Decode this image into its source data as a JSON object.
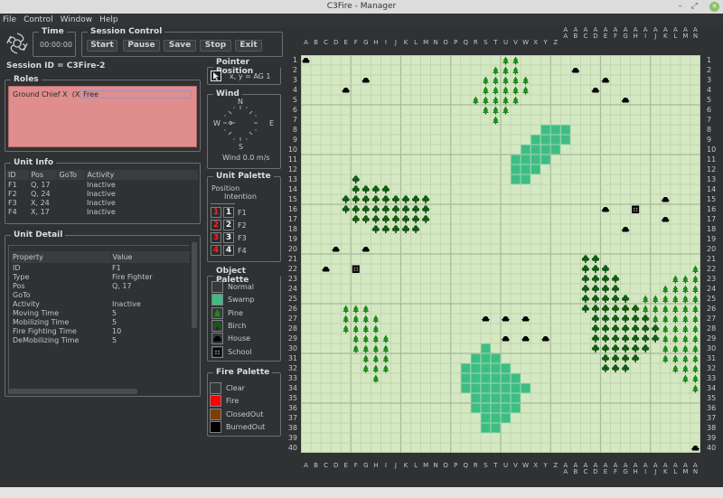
{
  "window": {
    "title": "C3Fire - Manager",
    "controls": {
      "minimize": "–",
      "maximize": "⤢",
      "close": "✕"
    }
  },
  "menu": [
    "File",
    "Control",
    "Window",
    "Help"
  ],
  "time": {
    "title": "Time",
    "value": "00:00:00"
  },
  "session_control": {
    "title": "Session Control",
    "buttons": [
      "Start",
      "Pause",
      "Save",
      "Stop",
      "Exit"
    ]
  },
  "session_id": "Session ID = C3Fire-2",
  "roles": {
    "title": "Roles",
    "role": "Ground Chief X",
    "marker": "(X)",
    "value": "Free"
  },
  "unit_info": {
    "title": "Unit Info",
    "columns": [
      "ID",
      "Pos",
      "GoTo",
      "Activity"
    ],
    "rows": [
      [
        "F1",
        "Q, 17",
        "",
        "Inactive"
      ],
      [
        "F2",
        "Q, 24",
        "",
        "Inactive"
      ],
      [
        "F3",
        "X, 24",
        "",
        "Inactive"
      ],
      [
        "F4",
        "X, 17",
        "",
        "Inactive"
      ]
    ]
  },
  "unit_detail": {
    "title": "Unit Detail",
    "columns": [
      "Property",
      "Value"
    ],
    "rows": [
      [
        "ID",
        "F1"
      ],
      [
        "Type",
        "Fire Fighter"
      ],
      [
        "Pos",
        "Q, 17"
      ],
      [
        "GoTo",
        ""
      ],
      [
        "Activity",
        "Inactive"
      ],
      [
        "Moving Time",
        "5"
      ],
      [
        "Mobilizing Time",
        "5"
      ],
      [
        "Fire Fighting Time",
        "10"
      ],
      [
        "DeMobilizing Time",
        "5"
      ]
    ]
  },
  "pointer_position": {
    "title": "Pointer Position",
    "icon": "arrow-pointer-icon",
    "text": "x, y  =  AG 1"
  },
  "wind": {
    "title": "Wind",
    "n": "N",
    "s": "S",
    "e": "E",
    "w": "W",
    "speed_text": "Wind 0.0 m/s"
  },
  "unit_palette": {
    "title": "Unit Palette",
    "position_label": "Position",
    "intention_label": "Intention",
    "units": [
      {
        "num": "1",
        "label": "F1"
      },
      {
        "num": "2",
        "label": "F2"
      },
      {
        "num": "3",
        "label": "F3"
      },
      {
        "num": "4",
        "label": "F4"
      }
    ]
  },
  "object_palette": {
    "title": "Object Palette",
    "items": [
      {
        "label": "Normal",
        "icon": "normal-icon",
        "color": "#36393c"
      },
      {
        "label": "Swamp",
        "icon": "swamp-icon",
        "color": "#3dbd84"
      },
      {
        "label": "Pine",
        "icon": "pine-icon",
        "color": "#1f8a1f"
      },
      {
        "label": "Birch",
        "icon": "birch-icon",
        "color": "#1c6e1c"
      },
      {
        "label": "House",
        "icon": "house-icon",
        "color": "#000000"
      },
      {
        "label": "School",
        "icon": "school-icon",
        "color": "#000000"
      }
    ]
  },
  "fire_palette": {
    "title": "Fire Palette",
    "items": [
      {
        "label": "Clear",
        "color": "#36393c"
      },
      {
        "label": "Fire",
        "color": "#ff0000"
      },
      {
        "label": "ClosedOut",
        "color": "#7a3e00"
      },
      {
        "label": "BurnedOut",
        "color": "#000000"
      }
    ]
  },
  "map": {
    "columns": [
      "A",
      "B",
      "C",
      "D",
      "E",
      "F",
      "G",
      "H",
      "I",
      "J",
      "K",
      "L",
      "M",
      "N",
      "O",
      "P",
      "Q",
      "R",
      "S",
      "T",
      "U",
      "V",
      "W",
      "X",
      "Y",
      "Z",
      "AA",
      "AB",
      "AC",
      "AD",
      "AE",
      "AF",
      "AG",
      "AH",
      "AI",
      "AJ",
      "AK",
      "AL",
      "AM",
      "AN"
    ],
    "rows": 40,
    "colors": {
      "ground": "#d4e8c2",
      "grid": "#bccfac",
      "major_grid": "#a9b89b",
      "swamp": "#3dbd84",
      "swamp_border": "#6fd3a2",
      "pine": "#1d8a1d",
      "birch": "#145c14",
      "house": "#000000"
    },
    "swamp": {
      "8": [
        "Y",
        "Z",
        "AA"
      ],
      "9": [
        "X",
        "Y",
        "Z",
        "AA"
      ],
      "10": [
        "W",
        "X",
        "Y",
        "Z"
      ],
      "11": [
        "V",
        "W",
        "X",
        "Y"
      ],
      "12": [
        "V",
        "W",
        "X"
      ],
      "13": [
        "V",
        "W"
      ],
      "30": [
        "S"
      ],
      "31": [
        "R",
        "S",
        "T"
      ],
      "32": [
        "Q",
        "R",
        "S",
        "T",
        "U"
      ],
      "33": [
        "Q",
        "R",
        "S",
        "T",
        "U",
        "V"
      ],
      "34": [
        "Q",
        "R",
        "S",
        "T",
        "U",
        "V",
        "W"
      ],
      "35": [
        "R",
        "S",
        "T",
        "U",
        "V"
      ],
      "36": [
        "R",
        "S",
        "T",
        "U",
        "V"
      ],
      "37": [
        "S",
        "T",
        "U"
      ],
      "38": [
        "S",
        "T"
      ]
    },
    "pine": {
      "1": [
        "U",
        "V"
      ],
      "2": [
        "T",
        "U",
        "V"
      ],
      "3": [
        "S",
        "T",
        "U",
        "V",
        "W"
      ],
      "4": [
        "S",
        "T",
        "U",
        "V",
        "W"
      ],
      "5": [
        "R",
        "S",
        "T",
        "U",
        "V"
      ],
      "6": [
        "S",
        "T",
        "U"
      ],
      "7": [
        "T"
      ],
      "22": [
        "AN"
      ],
      "23": [
        "AL",
        "AM",
        "AN"
      ],
      "24": [
        "AK",
        "AL",
        "AM",
        "AN"
      ],
      "25": [
        "AI",
        "AJ",
        "AK",
        "AL",
        "AM",
        "AN"
      ],
      "26": [
        "E",
        "F",
        "G",
        "AI",
        "AJ",
        "AK",
        "AL",
        "AM",
        "AN"
      ],
      "27": [
        "E",
        "F",
        "G",
        "H",
        "AJ",
        "AK",
        "AL",
        "AM",
        "AN"
      ],
      "28": [
        "E",
        "F",
        "G",
        "H",
        "AK",
        "AL",
        "AM",
        "AN"
      ],
      "29": [
        "F",
        "G",
        "H",
        "I",
        "AK",
        "AL",
        "AM",
        "AN"
      ],
      "30": [
        "F",
        "G",
        "H",
        "I",
        "AK",
        "AL",
        "AM",
        "AN"
      ],
      "31": [
        "G",
        "H",
        "I",
        "AK",
        "AL",
        "AM",
        "AN"
      ],
      "32": [
        "G",
        "H",
        "I",
        "AL",
        "AM",
        "AN"
      ],
      "33": [
        "H",
        "AM",
        "AN"
      ],
      "34": [
        "AN"
      ]
    },
    "birch": {
      "13": [
        "F"
      ],
      "14": [
        "F",
        "G",
        "H",
        "I"
      ],
      "15": [
        "E",
        "F",
        "G",
        "H",
        "I",
        "J",
        "K",
        "L",
        "M"
      ],
      "16": [
        "E",
        "F",
        "G",
        "H",
        "I",
        "J",
        "K",
        "L",
        "M"
      ],
      "17": [
        "F",
        "G",
        "H",
        "I",
        "J",
        "K",
        "L",
        "M"
      ],
      "18": [
        "H",
        "I",
        "J",
        "K",
        "L"
      ],
      "21": [
        "AC",
        "AD"
      ],
      "22": [
        "AC",
        "AD",
        "AE"
      ],
      "23": [
        "AC",
        "AD",
        "AE",
        "AF"
      ],
      "24": [
        "AC",
        "AD",
        "AE",
        "AF"
      ],
      "25": [
        "AC",
        "AD",
        "AE",
        "AF",
        "AG"
      ],
      "26": [
        "AC",
        "AD",
        "AE",
        "AF",
        "AG",
        "AH"
      ],
      "27": [
        "AD",
        "AE",
        "AF",
        "AG",
        "AH",
        "AI"
      ],
      "28": [
        "AD",
        "AE",
        "AF",
        "AG",
        "AH",
        "AI",
        "AJ"
      ],
      "29": [
        "AD",
        "AE",
        "AF",
        "AG",
        "AH",
        "AI",
        "AJ"
      ],
      "30": [
        "AD",
        "AE",
        "AF",
        "AG",
        "AH",
        "AI"
      ],
      "31": [
        "AE",
        "AF",
        "AG",
        "AH"
      ],
      "32": [
        "AE",
        "AF",
        "AG"
      ]
    },
    "house": {
      "1": [
        "A"
      ],
      "2": [
        "AB"
      ],
      "3": [
        "G",
        "AE"
      ],
      "4": [
        "E",
        "AD"
      ],
      "5": [
        "AG"
      ],
      "15": [
        "AK"
      ],
      "16": [
        "AE"
      ],
      "17": [
        "AK"
      ],
      "18": [
        "AG"
      ],
      "20": [
        "D",
        "G"
      ],
      "22": [
        "C"
      ],
      "27": [
        "S",
        "U",
        "W"
      ],
      "29": [
        "U",
        "W",
        "Y"
      ],
      "40": [
        "AN"
      ]
    },
    "school": {
      "16": [
        "AH"
      ],
      "22": [
        "F"
      ]
    }
  }
}
